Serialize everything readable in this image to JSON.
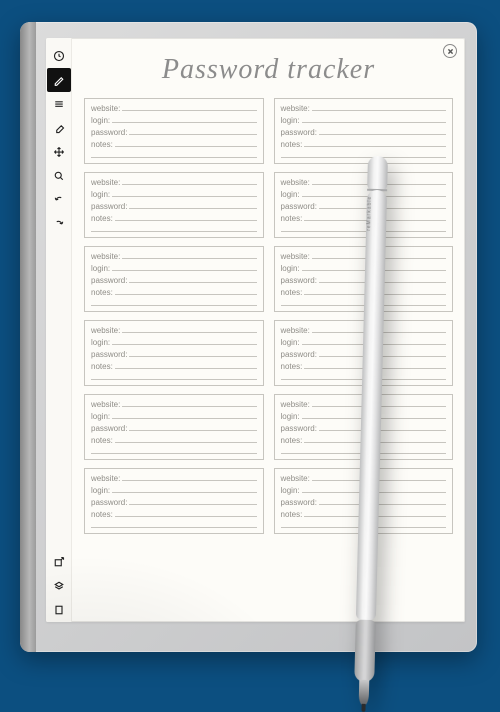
{
  "title": "Password tracker",
  "stylus_brand": "reMarkable",
  "fields": {
    "website": "website:",
    "login": "login:",
    "password": "password:",
    "notes": "notes:"
  },
  "entry_count": 12,
  "toolbar": [
    {
      "name": "clock-icon",
      "active": false
    },
    {
      "name": "pen-icon",
      "active": true
    },
    {
      "name": "lines-icon",
      "active": false
    },
    {
      "name": "eraser-icon",
      "active": false
    },
    {
      "name": "move-icon",
      "active": false
    },
    {
      "name": "zoom-icon",
      "active": false
    },
    {
      "name": "undo-icon",
      "active": false
    },
    {
      "name": "redo-icon",
      "active": false
    }
  ],
  "toolbar_bottom": [
    {
      "name": "export-icon"
    },
    {
      "name": "layers-icon"
    },
    {
      "name": "page-icon"
    }
  ]
}
